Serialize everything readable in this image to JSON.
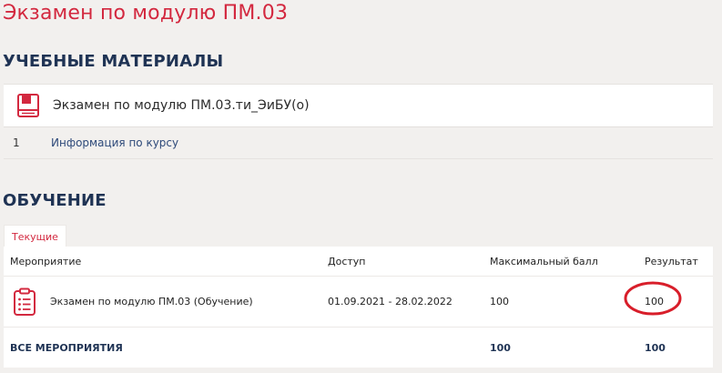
{
  "page": {
    "title": "Экзамен по модулю ПМ.03"
  },
  "materials": {
    "section_title": "УЧЕБНЫЕ МАТЕРИАЛЫ",
    "item_title": "Экзамен по модулю ПМ.03.ти_ЭиБУ(о)",
    "item_icon": "book-icon",
    "info_number": "1",
    "info_link": "Информация по курсу"
  },
  "training": {
    "section_title": "ОБУЧЕНИЕ",
    "tab_label": "Текущие",
    "columns": [
      "Мероприятие",
      "Доступ",
      "Максимальный балл",
      "Результат"
    ],
    "rows": [
      {
        "event": "Экзамен по модулю ПМ.03 (Обучение)",
        "event_icon": "clipboard-list-icon",
        "access": "01.09.2021 - 28.02.2022",
        "max_score": "100",
        "result": "100"
      }
    ],
    "total": {
      "label": "ВСЕ МЕРОПРИЯТИЯ",
      "max_score": "100",
      "result": "100"
    }
  },
  "colors": {
    "accent_red": "#d3283f",
    "heading_blue": "#1f3354",
    "link_blue": "#2e4a7a",
    "annotation_circle": "#d81e2a",
    "background": "#f2f0ee"
  }
}
